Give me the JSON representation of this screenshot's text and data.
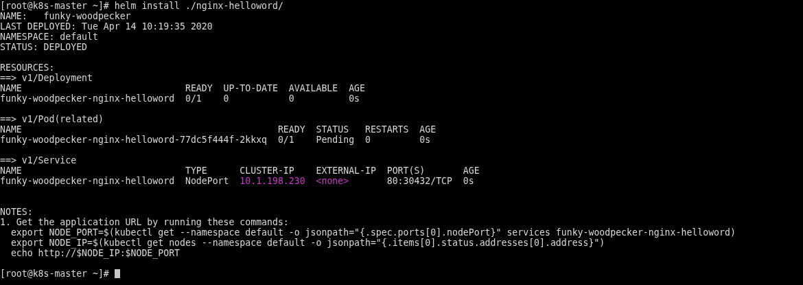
{
  "terminal": {
    "lines": [
      {
        "kind": "text",
        "segments": [
          {
            "text": "[root@k8s-master ~]# helm install ./nginx-helloword/",
            "highlight": false
          }
        ]
      },
      {
        "kind": "text",
        "segments": [
          {
            "text": "NAME:   funky-woodpecker",
            "highlight": false
          }
        ]
      },
      {
        "kind": "text",
        "segments": [
          {
            "text": "LAST DEPLOYED: Tue Apr 14 10:19:35 2020",
            "highlight": false
          }
        ]
      },
      {
        "kind": "text",
        "segments": [
          {
            "text": "NAMESPACE: default",
            "highlight": false
          }
        ]
      },
      {
        "kind": "text",
        "segments": [
          {
            "text": "STATUS: DEPLOYED",
            "highlight": false
          }
        ]
      },
      {
        "kind": "blank"
      },
      {
        "kind": "text",
        "segments": [
          {
            "text": "RESOURCES:",
            "highlight": false
          }
        ]
      },
      {
        "kind": "text",
        "segments": [
          {
            "text": "==> v1/Deployment",
            "highlight": false
          }
        ]
      },
      {
        "kind": "text",
        "segments": [
          {
            "text": "NAME                              READY  UP-TO-DATE  AVAILABLE  AGE",
            "highlight": false
          }
        ]
      },
      {
        "kind": "text",
        "segments": [
          {
            "text": "funky-woodpecker-nginx-helloword  0/1    0           0          0s",
            "highlight": false
          }
        ]
      },
      {
        "kind": "blank"
      },
      {
        "kind": "text",
        "segments": [
          {
            "text": "==> v1/Pod(related)",
            "highlight": false
          }
        ]
      },
      {
        "kind": "text",
        "segments": [
          {
            "text": "NAME                                               READY  STATUS   RESTARTS  AGE",
            "highlight": false
          }
        ]
      },
      {
        "kind": "text",
        "segments": [
          {
            "text": "funky-woodpecker-nginx-helloword-77dc5f444f-2kkxq  0/1    Pending  0         0s",
            "highlight": false
          }
        ]
      },
      {
        "kind": "blank"
      },
      {
        "kind": "text",
        "segments": [
          {
            "text": "==> v1/Service",
            "highlight": false
          }
        ]
      },
      {
        "kind": "text",
        "segments": [
          {
            "text": "NAME                              TYPE      CLUSTER-IP    EXTERNAL-IP  PORT(S)       AGE",
            "highlight": false
          }
        ]
      },
      {
        "kind": "text",
        "segments": [
          {
            "text": "funky-woodpecker-nginx-helloword  NodePort  ",
            "highlight": false
          },
          {
            "text": "10.1.198.230  ",
            "highlight": true
          },
          {
            "text": "<none>",
            "highlight": true
          },
          {
            "text": "       80:30432/TCP  0s",
            "highlight": false
          }
        ]
      },
      {
        "kind": "blank"
      },
      {
        "kind": "blank"
      },
      {
        "kind": "text",
        "segments": [
          {
            "text": "NOTES:",
            "highlight": false
          }
        ]
      },
      {
        "kind": "text",
        "segments": [
          {
            "text": "1. Get the application URL by running these commands:",
            "highlight": false
          }
        ]
      },
      {
        "kind": "text",
        "segments": [
          {
            "text": "  export NODE_PORT=$(kubectl get --namespace default -o jsonpath=\"{.spec.ports[0].nodePort}\" services funky-woodpecker-nginx-helloword)",
            "highlight": false
          }
        ]
      },
      {
        "kind": "text",
        "segments": [
          {
            "text": "  export NODE_IP=$(kubectl get nodes --namespace default -o jsonpath=\"{.items[0].status.addresses[0].address}\")",
            "highlight": false
          }
        ]
      },
      {
        "kind": "text",
        "segments": [
          {
            "text": "  echo http://$NODE_IP:$NODE_PORT",
            "highlight": false
          }
        ]
      },
      {
        "kind": "blank"
      },
      {
        "kind": "prompt",
        "segments": [
          {
            "text": "[root@k8s-master ~]# ",
            "highlight": false
          }
        ]
      }
    ]
  }
}
